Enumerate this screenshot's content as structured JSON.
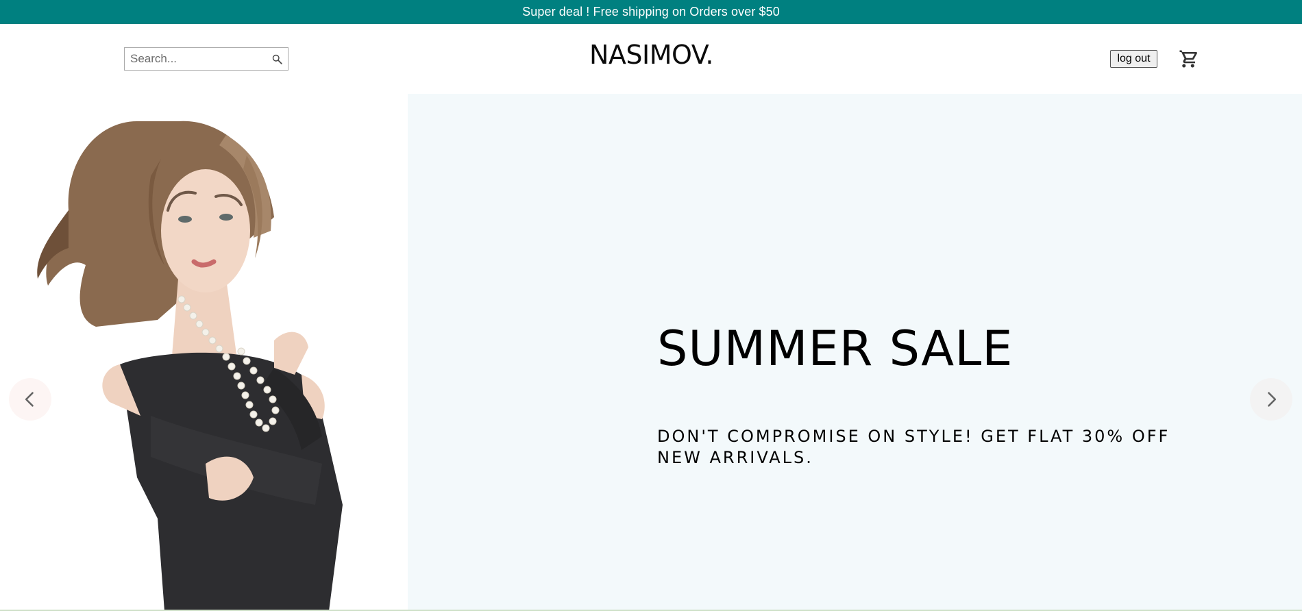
{
  "announcement": {
    "text": "Super deal ! Free shipping on Orders over $50"
  },
  "header": {
    "search": {
      "placeholder": "Search...",
      "value": ""
    },
    "logo": "NASIMOV.",
    "logout_label": "log out"
  },
  "slide": {
    "title": "SUMMER SALE",
    "description": "DON'T COMPROMISE ON STYLE! GET FLAT 30% OFF NEW ARRIVALS.",
    "background": "#f3f9fb"
  },
  "colors": {
    "announcement_bg": "#008080",
    "announcement_text": "#ffffff",
    "logo": "#0b0b0b"
  },
  "icons": {
    "search": "search-icon",
    "cart": "shopping-cart-icon",
    "prev": "chevron-left-icon",
    "next": "chevron-right-icon"
  }
}
